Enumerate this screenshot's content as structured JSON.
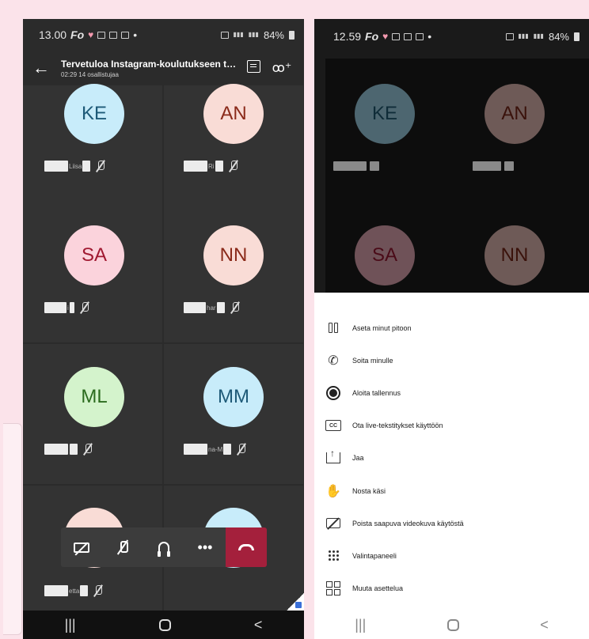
{
  "left_phone": {
    "status": {
      "time": "13.00",
      "brand": "Fo",
      "battery": "84%"
    },
    "header": {
      "title": "Tervetuloa Instagram-koulutukseen to 2...",
      "subtitle": "02:29 14 osallistujaa"
    },
    "tiles": [
      {
        "initials": "KE",
        "bg": "#c8ecfa",
        "fg": "#1e5a78",
        "name_hint": "Liisa"
      },
      {
        "initials": "AN",
        "bg": "#f9dcd6",
        "fg": "#8a2a1a",
        "name_hint": "Ri"
      },
      {
        "initials": "SA",
        "bg": "#fbd3dc",
        "fg": "#a01830",
        "name_hint": "i"
      },
      {
        "initials": "NN",
        "bg": "#f9dcd6",
        "fg": "#8a2a1a",
        "name_hint": "har"
      },
      {
        "initials": "ML",
        "bg": "#d4f3cc",
        "fg": "#2b6b1e",
        "name_hint": ""
      },
      {
        "initials": "MM",
        "bg": "#c8ecfa",
        "fg": "#1e5a78",
        "name_hint": "na-M"
      },
      {
        "initials": "",
        "bg": "#f9dcd6",
        "fg": "#8a2a1a",
        "name_hint": "etta"
      },
      {
        "initials": "",
        "bg": "#c8ecfa",
        "fg": "#1e5a78",
        "name_hint": ""
      }
    ],
    "controls": {
      "more_label": "•••"
    },
    "nav": {
      "recents": "|||",
      "back": "<"
    }
  },
  "right_phone": {
    "status": {
      "time": "12.59",
      "brand": "Fo",
      "battery": "84%"
    },
    "dim_tiles": [
      {
        "initials": "KE",
        "bg": "#4d6670",
        "fg": "#0f2c38"
      },
      {
        "initials": "AN",
        "bg": "#6e5a57",
        "fg": "#3a120b"
      },
      {
        "initials": "SA",
        "bg": "#6f5258",
        "fg": "#4a0b18"
      },
      {
        "initials": "NN",
        "bg": "#6e5a57",
        "fg": "#3a120b"
      }
    ],
    "menu": [
      {
        "icon": "pause-icon",
        "label": "Aseta minut pitoon"
      },
      {
        "icon": "call-me-icon",
        "label": "Soita minulle"
      },
      {
        "icon": "record-icon",
        "label": "Aloita tallennus"
      },
      {
        "icon": "captions-icon",
        "label": "Ota live-tekstitykset käyttöön"
      },
      {
        "icon": "share-icon",
        "label": "Jaa"
      },
      {
        "icon": "raise-hand-icon",
        "label": "Nosta käsi"
      },
      {
        "icon": "video-off-icon",
        "label": "Poista saapuva videokuva käytöstä"
      },
      {
        "icon": "dialpad-icon",
        "label": "Valintapaneeli"
      },
      {
        "icon": "layout-icon",
        "label": "Muuta asettelua"
      }
    ],
    "nav": {
      "recents": "|||",
      "back": "<"
    }
  }
}
